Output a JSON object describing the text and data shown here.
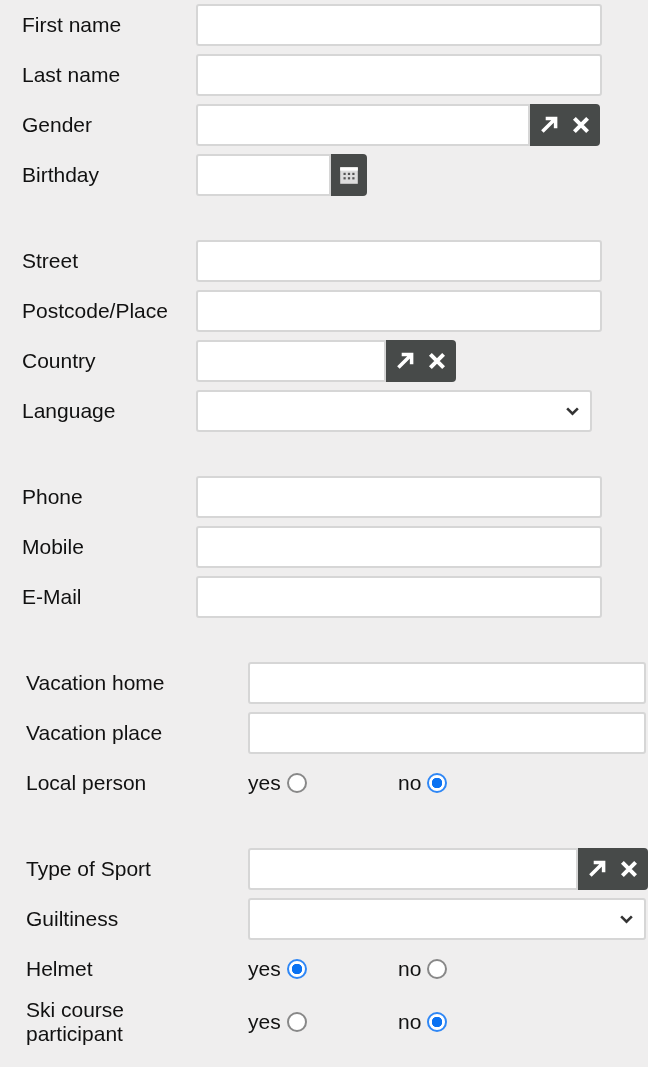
{
  "groups": [
    {
      "fields": [
        {
          "label": "First name",
          "kind": "text"
        },
        {
          "label": "Last name",
          "kind": "text"
        },
        {
          "label": "Gender",
          "kind": "lookup"
        },
        {
          "label": "Birthday",
          "kind": "date"
        }
      ]
    },
    {
      "fields": [
        {
          "label": "Street",
          "kind": "text"
        },
        {
          "label": "Postcode/Place",
          "kind": "text"
        },
        {
          "label": "Country",
          "kind": "minilookup"
        },
        {
          "label": "Language",
          "kind": "select"
        }
      ]
    },
    {
      "fields": [
        {
          "label": "Phone",
          "kind": "text"
        },
        {
          "label": "Mobile",
          "kind": "text"
        },
        {
          "label": "E-Mail",
          "kind": "text"
        }
      ]
    },
    {
      "fields": [
        {
          "label": "Vacation home",
          "kind": "text"
        },
        {
          "label": "Vacation place",
          "kind": "text"
        },
        {
          "label": "Local person",
          "kind": "radio",
          "options": [
            {
              "label": "yes",
              "selected": false
            },
            {
              "label": "no",
              "selected": true
            }
          ]
        }
      ]
    },
    {
      "fields": [
        {
          "label": "Type of Sport",
          "kind": "lookup"
        },
        {
          "label": "Guiltiness",
          "kind": "select"
        },
        {
          "label": "Helmet",
          "kind": "radio",
          "options": [
            {
              "label": "yes",
              "selected": true
            },
            {
              "label": "no",
              "selected": false
            }
          ]
        },
        {
          "label": "Ski course participant",
          "kind": "radio",
          "options": [
            {
              "label": "yes",
              "selected": false
            },
            {
              "label": "no",
              "selected": true
            }
          ]
        }
      ]
    }
  ]
}
